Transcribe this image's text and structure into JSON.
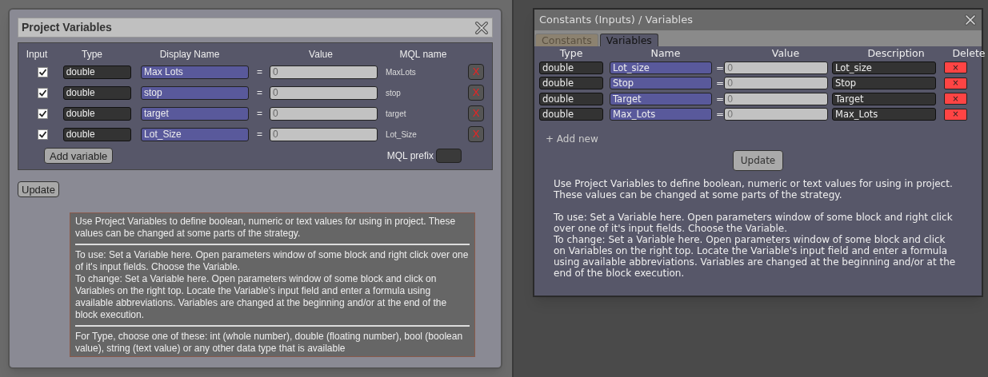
{
  "project_variables": {
    "title": "Project Variables",
    "columns": [
      "Input",
      "Type",
      "Display Name",
      "Value",
      "MQL name"
    ],
    "rows": [
      {
        "input": true,
        "type": "double",
        "display_name": "Max Lots",
        "equals": "=",
        "value": "0",
        "mql_name": "MaxLots",
        "delete": "X"
      },
      {
        "input": true,
        "type": "double",
        "display_name": "stop",
        "equals": "=",
        "value": "0",
        "mql_name": "stop",
        "delete": "X"
      },
      {
        "input": true,
        "type": "double",
        "display_name": "target",
        "equals": "=",
        "value": "0",
        "mql_name": "target",
        "delete": "X"
      },
      {
        "input": true,
        "type": "double",
        "display_name": "Lot_Size",
        "equals": "=",
        "value": "0",
        "mql_name": "Lot_Size",
        "delete": "X"
      }
    ],
    "add_button": "Add variable",
    "mql_prefix_label": "MQL prefix",
    "update_button": "Update",
    "help_sections": [
      [
        "Use Project Variables to define boolean, numeric or text values for using in project. These values can be changed at some parts of the strategy."
      ],
      [
        "To use: Set a Variable here. Open parameters window of some block and right click over one of it's input fields. Choose the Variable.",
        "To change: Set a Variable here. Open parameters window of some block and click on Variables on the right top. Locate the Variable's input field and enter a formula using available abbreviations. Variables are changed at the beginning and/or at the end of the block execution."
      ],
      [
        "For Type, choose one of these: int (whole number), double (floating number), bool (boolean value), string (text value) or any other data type that is available"
      ]
    ]
  },
  "constants_dialog": {
    "title": "Constants (Inputs) / Variables",
    "tabs": [
      {
        "label": "Constants",
        "selected": false
      },
      {
        "label": "Variables",
        "selected": true
      }
    ],
    "columns": [
      "Type",
      "Name",
      "Value",
      "Description",
      "Delete"
    ],
    "rows": [
      {
        "type": "double",
        "name": "Lot_size",
        "equals": "=",
        "value": "0",
        "description": "Lot_size",
        "delete": "×"
      },
      {
        "type": "double",
        "name": "Stop",
        "equals": "=",
        "value": "0",
        "description": "Stop",
        "delete": "×"
      },
      {
        "type": "double",
        "name": "Target",
        "equals": "=",
        "value": "0",
        "description": "Target",
        "delete": "×"
      },
      {
        "type": "double",
        "name": "Max_Lots",
        "equals": "=",
        "value": "0",
        "description": "Max_Lots",
        "delete": "×"
      }
    ],
    "add_link": "+ Add new",
    "update_button": "Update",
    "help_paragraphs": [
      [
        "Use Project Variables to define boolean, numeric or text values for using in project. These values can be changed at some parts of the strategy."
      ],
      [
        "To use: Set a Variable here. Open parameters window of some block and right click over one of it's input fields. Choose the Variable.",
        "To change: Set a Variable here. Open parameters window of some block and click on Variables on the right top. Locate the Variable's input field and enter a formula using available abbreviations. Variables are changed at the beginning and/or at the end of the block execution."
      ]
    ]
  }
}
